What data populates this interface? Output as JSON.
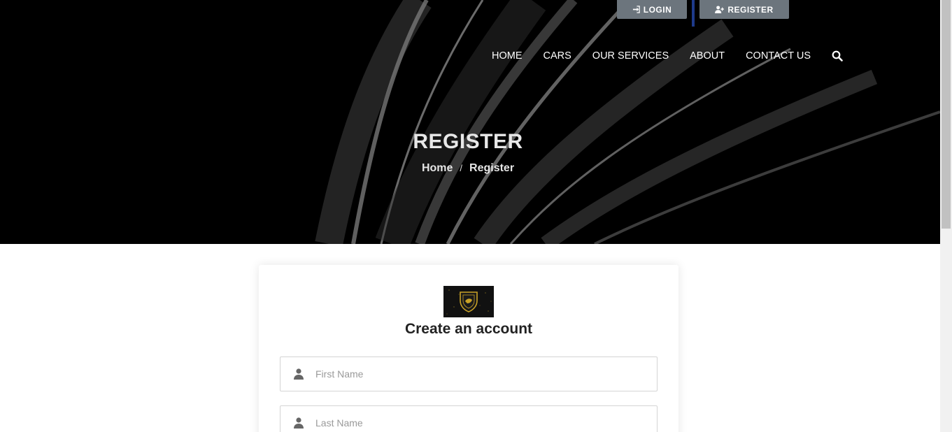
{
  "top_bar": {
    "login_label": "LOGIN",
    "register_label": "REGISTER"
  },
  "nav": {
    "items": [
      "HOME",
      "CARS",
      "OUR SERVICES",
      "ABOUT",
      "CONTACT US"
    ]
  },
  "hero": {
    "title": "REGISTER",
    "breadcrumb": {
      "home": "Home",
      "separator": "/",
      "current": "Register"
    }
  },
  "form": {
    "heading": "Create an account",
    "first_name_placeholder": "First Name",
    "last_name_placeholder": "Last Name"
  },
  "colors": {
    "hero_bg": "#000000",
    "top_button": "#6c757d",
    "accent_separator": "#1e3a8a",
    "logo_gold": "#c9a227"
  },
  "icons": {
    "login": "sign-in-icon",
    "register": "user-plus-icon",
    "search": "search-icon",
    "field": "user-icon"
  }
}
